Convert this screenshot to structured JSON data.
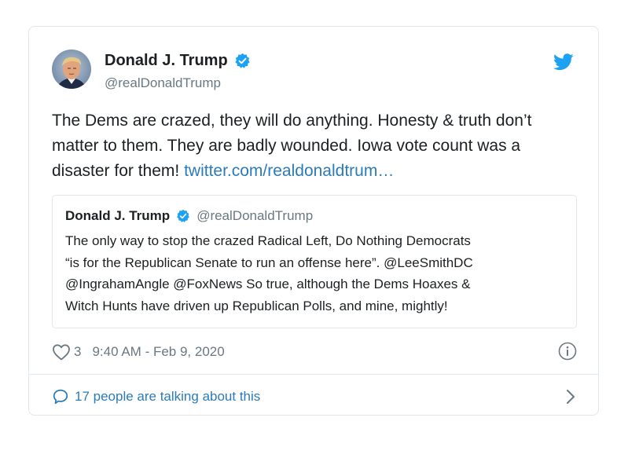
{
  "author": {
    "name": "Donald J. Trump",
    "handle": "@realDonaldTrump"
  },
  "tweet": {
    "text": "The Dems are crazed, they will do anything. Honesty & truth don’t matter to them. They are badly wounded. Iowa vote count was a disaster for them! ",
    "link_text": "twitter.com/realdonaldtrum…"
  },
  "quoted_tweet": {
    "author_name": "Donald J. Trump",
    "author_handle": "@realDonaldTrump",
    "text": "The only way to stop the crazed Radical Left, Do Nothing Democrats\n“is for the Republican Senate to run an offense here”. @LeeSmithDC\n@IngrahamAngle  @FoxNews So true, although the Dems Hoaxes &\nWitch Hunts have driven up Republican Polls, and mine, mightly!"
  },
  "meta": {
    "like_count": "3",
    "timestamp": "9:40 AM - Feb 9, 2020"
  },
  "footer": {
    "talking_text": "17 people are talking about this"
  },
  "colors": {
    "text": "#1c2022",
    "secondary_text": "#697882",
    "link": "#2b7bb9",
    "verified": "#1da1f2",
    "border": "#e1e8ed"
  },
  "icons": [
    "avatar",
    "verified-badge-icon",
    "twitter-bird-icon",
    "heart-icon",
    "info-icon",
    "speech-bubble-icon",
    "chevron-right-icon"
  ]
}
